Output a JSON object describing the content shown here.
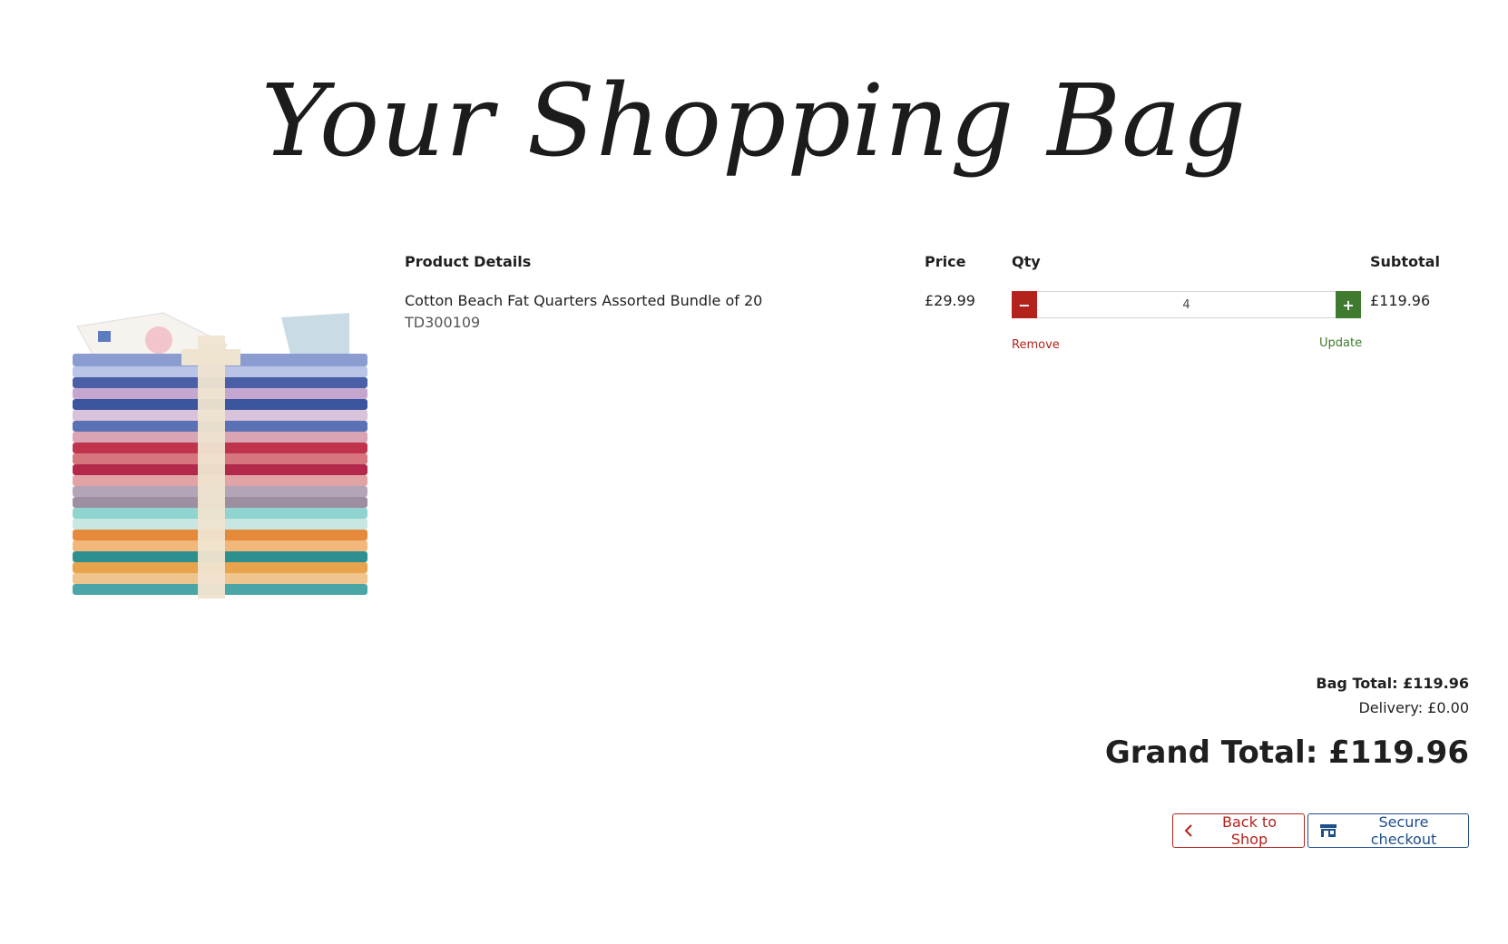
{
  "page": {
    "title": "Your Shopping Bag"
  },
  "table": {
    "headers": {
      "product": "Product Details",
      "price": "Price",
      "qty": "Qty",
      "subtotal": "Subtotal"
    },
    "items": [
      {
        "name": "Cotton Beach Fat Quarters Assorted Bundle of 20",
        "sku": "TD300109",
        "price": "£29.99",
        "qty": "4",
        "subtotal": "£119.96",
        "remove_label": "Remove",
        "update_label": "Update",
        "image_icon": "fabric-bundle-image"
      }
    ]
  },
  "totals": {
    "bag_total": "Bag Total: £119.96",
    "delivery": "Delivery: £0.00",
    "grand_total": "Grand Total: £119.96"
  },
  "actions": {
    "back_label": "Back to Shop",
    "checkout_label": "Secure checkout",
    "back_icon": "chevron-left-icon",
    "checkout_icon": "shop-icon"
  },
  "colors": {
    "danger": "#b3221b",
    "success": "#3f7a2e",
    "primary": "#1f4e8c"
  }
}
